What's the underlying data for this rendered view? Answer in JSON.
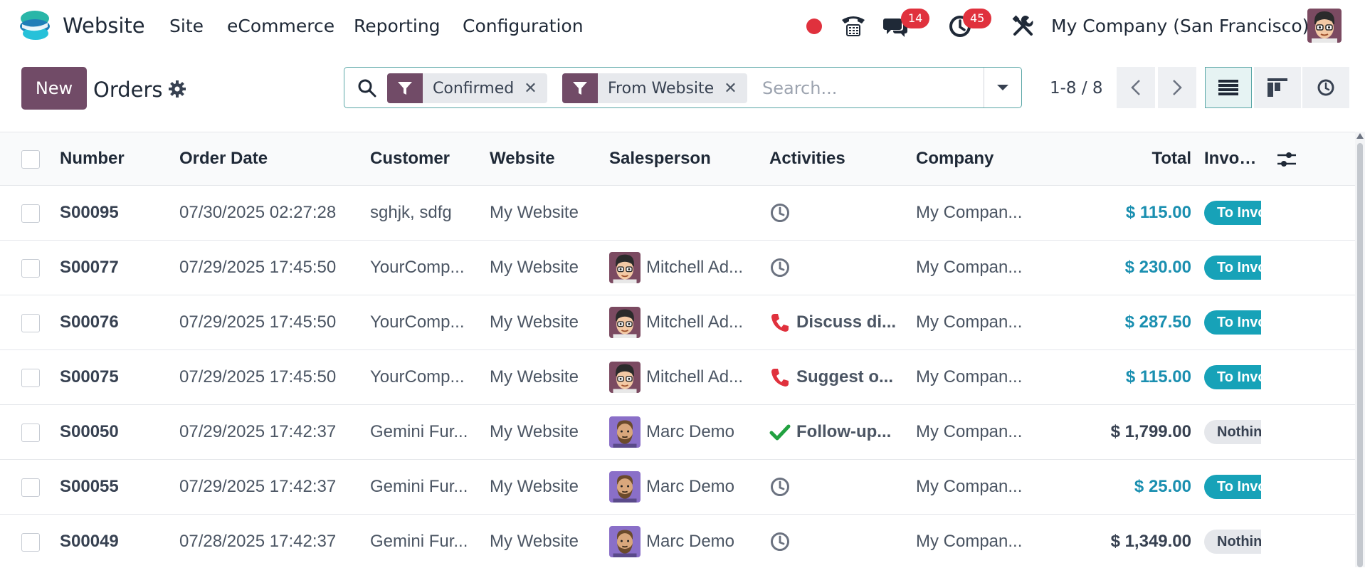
{
  "app": {
    "name": "Website",
    "menu": [
      "Site",
      "eCommerce",
      "Reporting",
      "Configuration"
    ],
    "company": "My Company (San Francisco)",
    "messages_count": "14",
    "activities_count": "45",
    "colors": {
      "brand": "#714b67",
      "badge": "#e0313d",
      "accent": "#17a2b8"
    }
  },
  "control": {
    "new_label": "New",
    "title": "Orders",
    "facets": [
      {
        "label": "Confirmed"
      },
      {
        "label": "From Website"
      }
    ],
    "search_placeholder": "Search...",
    "pager": "1-8 / 8"
  },
  "table": {
    "columns": [
      "Number",
      "Order Date",
      "Customer",
      "Website",
      "Salesperson",
      "Activities",
      "Company",
      "Total",
      "Invoice St..."
    ],
    "rows": [
      {
        "number": "S00095",
        "date": "07/30/2025 02:27:28",
        "customer": "sghjk, sdfg",
        "website": "My Website",
        "salesperson": "",
        "avatar": "",
        "activity_icon": "clock-icon",
        "activity": "",
        "company": "My Compan...",
        "total": "$ 115.00",
        "total_style": "blue",
        "status": "To Invoice",
        "status_style": "to-invoice"
      },
      {
        "number": "S00077",
        "date": "07/29/2025 17:45:50",
        "customer": "YourComp...",
        "website": "My Website",
        "salesperson": "Mitchell Ad...",
        "avatar": "mitchell",
        "activity_icon": "clock-icon",
        "activity": "",
        "company": "My Compan...",
        "total": "$ 230.00",
        "total_style": "blue",
        "status": "To Invoice",
        "status_style": "to-invoice"
      },
      {
        "number": "S00076",
        "date": "07/29/2025 17:45:50",
        "customer": "YourComp...",
        "website": "My Website",
        "salesperson": "Mitchell Ad...",
        "avatar": "mitchell",
        "activity_icon": "phone-icon",
        "activity": "Discuss di...",
        "company": "My Compan...",
        "total": "$ 287.50",
        "total_style": "blue",
        "status": "To Invoice",
        "status_style": "to-invoice"
      },
      {
        "number": "S00075",
        "date": "07/29/2025 17:45:50",
        "customer": "YourComp...",
        "website": "My Website",
        "salesperson": "Mitchell Ad...",
        "avatar": "mitchell",
        "activity_icon": "phone-icon",
        "activity": "Suggest o...",
        "company": "My Compan...",
        "total": "$ 115.00",
        "total_style": "blue",
        "status": "To Invoice",
        "status_style": "to-invoice"
      },
      {
        "number": "S00050",
        "date": "07/29/2025 17:42:37",
        "customer": "Gemini Fur...",
        "website": "My Website",
        "salesperson": "Marc Demo",
        "avatar": "marc",
        "activity_icon": "check-icon",
        "activity": "Follow-up...",
        "company": "My Compan...",
        "total": "$ 1,799.00",
        "total_style": "dark",
        "status": "Nothing ...",
        "status_style": "nothing"
      },
      {
        "number": "S00055",
        "date": "07/29/2025 17:42:37",
        "customer": "Gemini Fur...",
        "website": "My Website",
        "salesperson": "Marc Demo",
        "avatar": "marc",
        "activity_icon": "clock-icon",
        "activity": "",
        "company": "My Compan...",
        "total": "$ 25.00",
        "total_style": "blue",
        "status": "To Invoice",
        "status_style": "to-invoice"
      },
      {
        "number": "S00049",
        "date": "07/28/2025 17:42:37",
        "customer": "Gemini Fur...",
        "website": "My Website",
        "salesperson": "Marc Demo",
        "avatar": "marc",
        "activity_icon": "clock-icon",
        "activity": "",
        "company": "My Compan...",
        "total": "$ 1,349.00",
        "total_style": "dark",
        "status": "Nothing ...",
        "status_style": "nothing"
      }
    ]
  }
}
